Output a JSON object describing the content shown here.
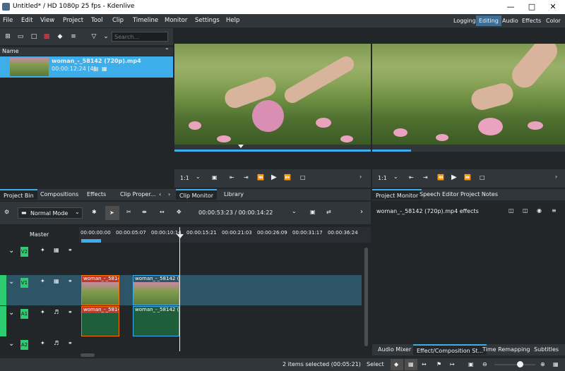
{
  "window": {
    "title": "Untitled* / HD 1080p 25 fps - Kdenlive"
  },
  "menu": [
    "File",
    "Edit",
    "View",
    "Project",
    "Tool",
    "Clip",
    "Timeline",
    "Monitor",
    "Settings",
    "Help"
  ],
  "workspaces": [
    "Logging",
    "Editing",
    "Audio",
    "Effects",
    "Color"
  ],
  "workspace_active": "Editing",
  "bin": {
    "search_placeholder": "Search...",
    "column_name": "Name",
    "clip_name": "woman_-_58142 (720p).mp4",
    "clip_info": "00:00:12:24 [4]"
  },
  "clip_monitor": {
    "zoom": "1:1"
  },
  "project_monitor": {
    "zoom": "1:1"
  },
  "left_tabs": [
    "Project Bin",
    "Compositions",
    "Effects",
    "Clip Proper..."
  ],
  "monitor_tabs": [
    "Clip Monitor",
    "Library"
  ],
  "right_tabs": [
    "Project Monitor",
    "Speech Editor",
    "Project Notes"
  ],
  "timeline": {
    "edit_mode": "Normal Mode",
    "timecode": "00:00:53:23 / 00:00:14:22",
    "master": "Master",
    "ruler": [
      "00:00:00:00",
      "00:00:05:07",
      "00:00:10:14",
      "00:00:15:21",
      "00:00:21:03",
      "00:00:26:09",
      "00:00:31:17",
      "00:00:36:24"
    ],
    "tracks": [
      "V2",
      "V1",
      "A1",
      "A2"
    ],
    "clips": {
      "v1_a": "woman_-_5814",
      "v1_b": "woman_-_58142 (7",
      "a1_a": "woman_-_58142",
      "a1_b": "woman_-_58142 (7"
    }
  },
  "effects_panel": {
    "title": "woman_-_58142 (720p).mp4 effects"
  },
  "bottom_tabs": [
    "Audio Mixer",
    "Effect/Composition St...",
    "Time Remapping",
    "Subtitles"
  ],
  "status": {
    "selection": "2 items selected (00:05:21)",
    "select_label": "Select"
  }
}
